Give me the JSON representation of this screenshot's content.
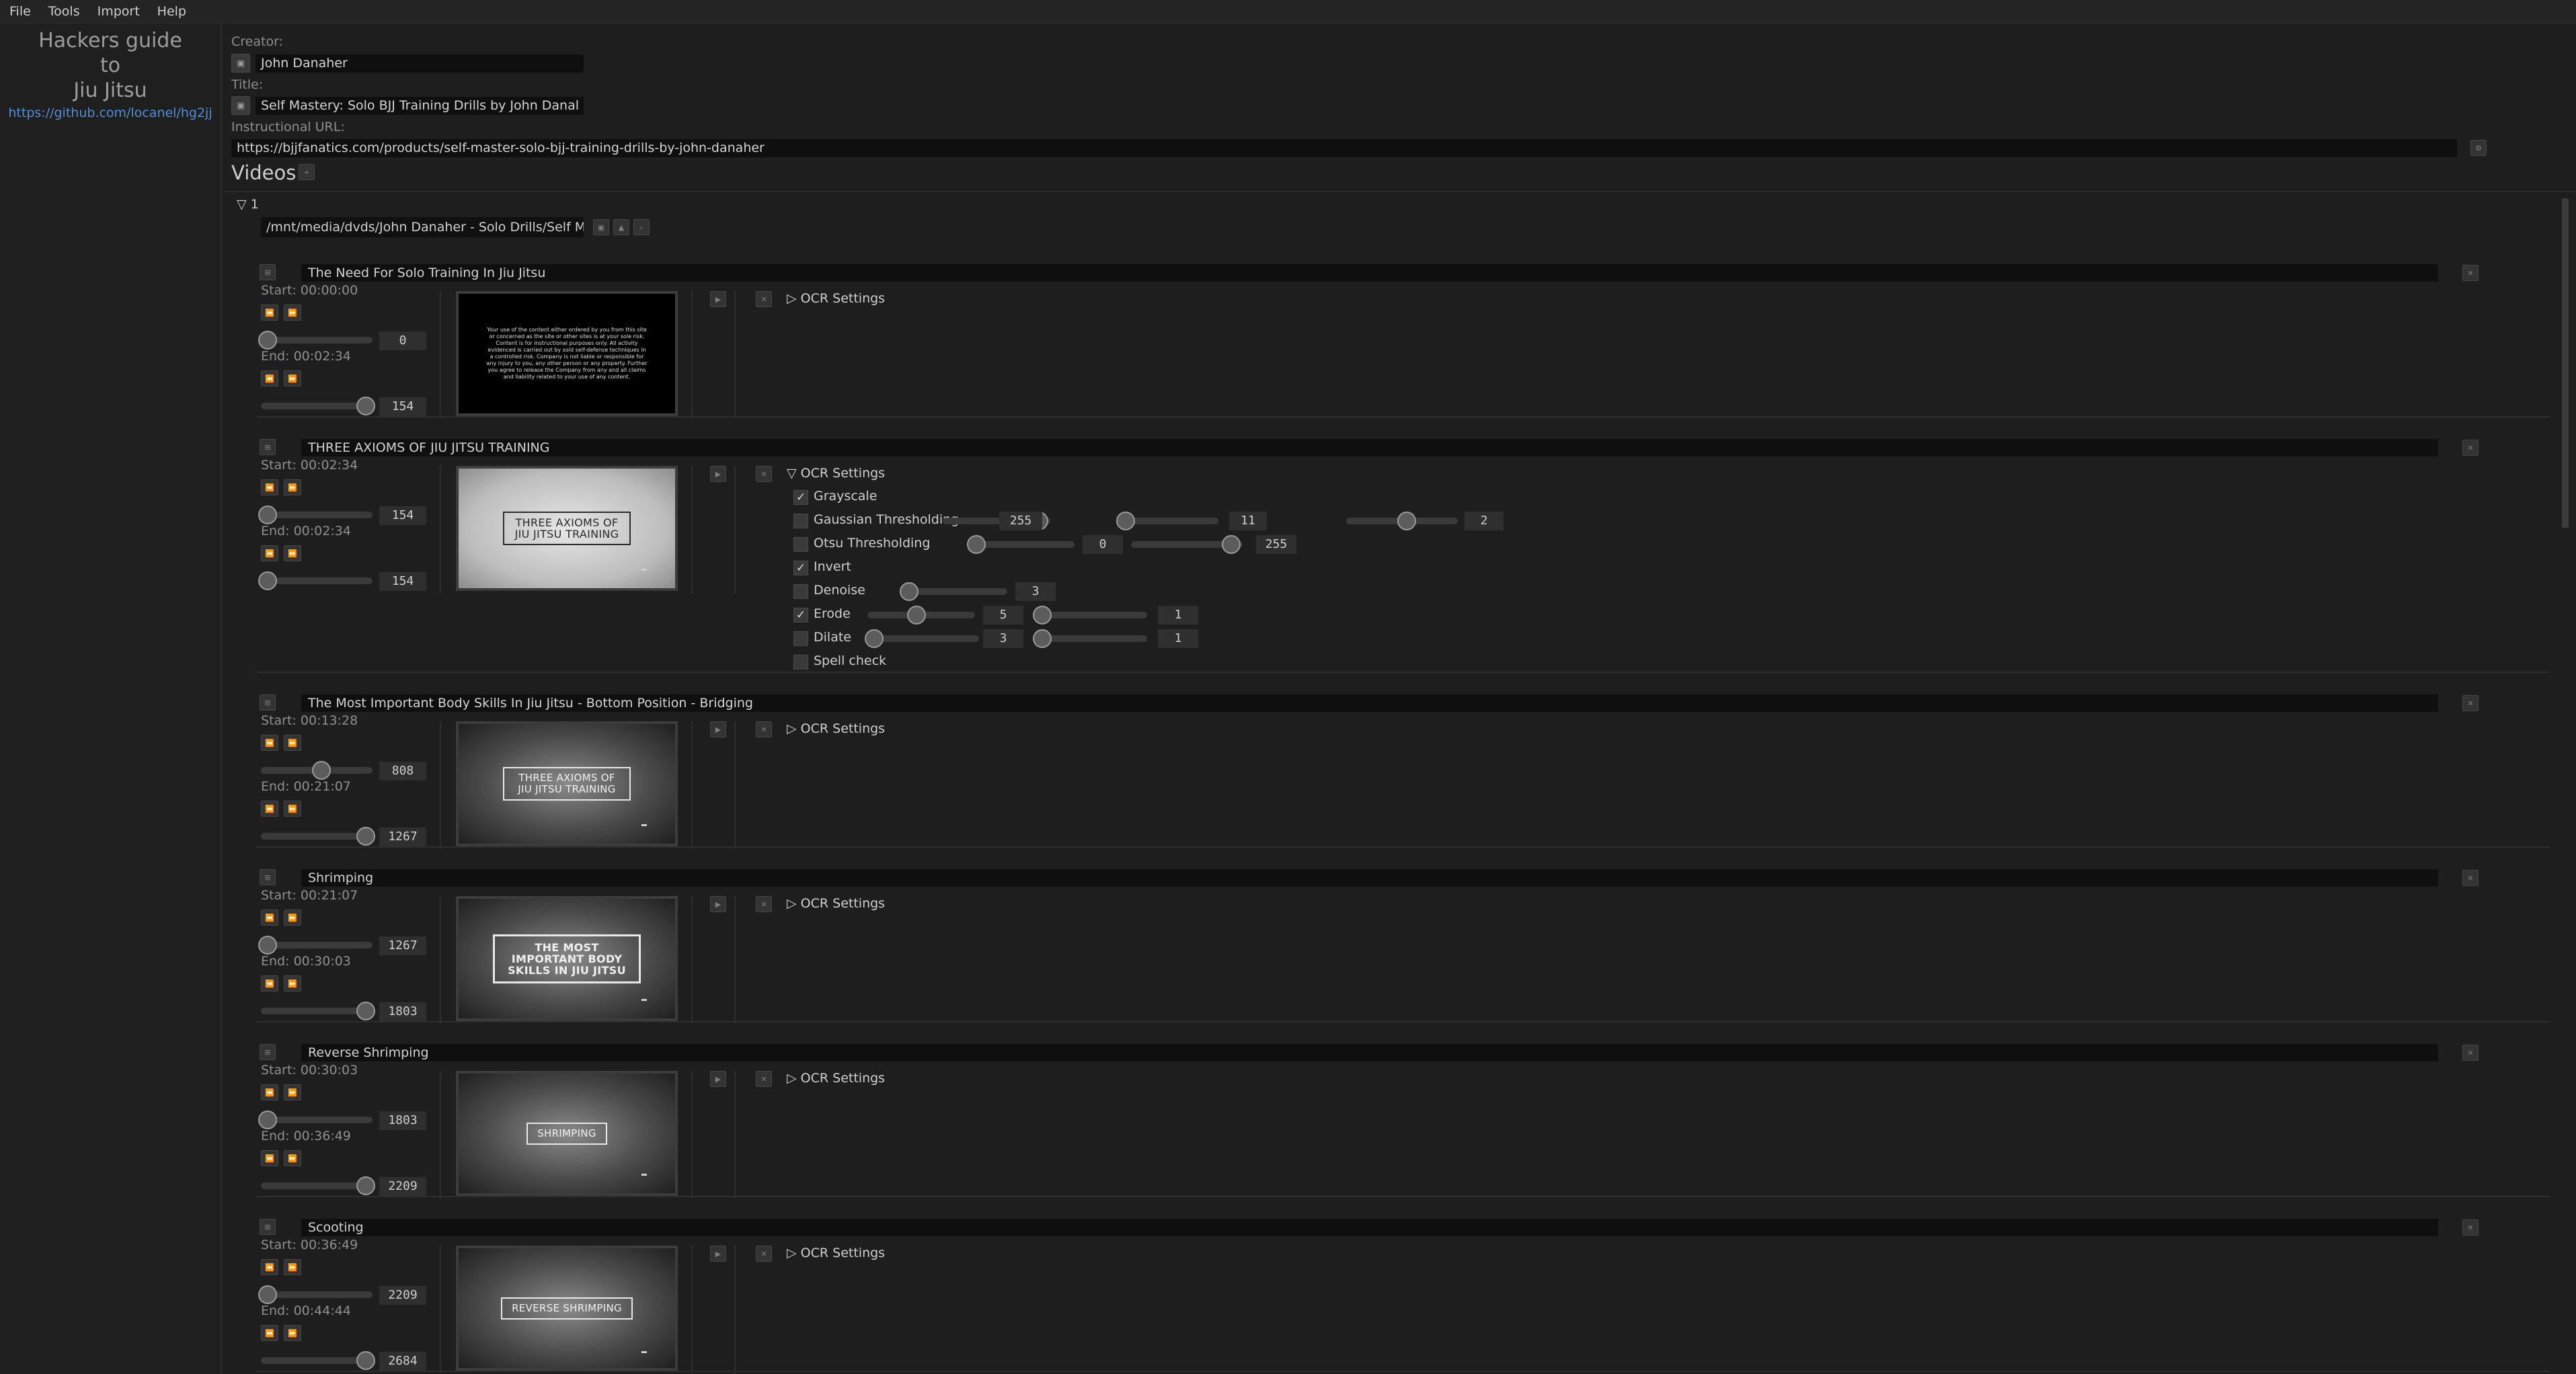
{
  "menu": [
    "File",
    "Tools",
    "Import",
    "Help"
  ],
  "sidebar": {
    "brand_line1": "Hackers guide",
    "brand_line2": "to",
    "brand_line3": "Jiu Jitsu",
    "link": "https://github.com/locanel/hg2jj"
  },
  "form": {
    "creator_label": "Creator:",
    "creator_value": "John Danaher",
    "title_label": "Title:",
    "title_value": "Self Mastery: Solo BJJ Training Drills by John Danal",
    "url_label": "Instructional URL:",
    "url_value": "https://bjjfanatics.com/products/self-master-solo-bjj-training-drills-by-john-danaher"
  },
  "videos": {
    "heading": "Videos",
    "add_glyph": "+",
    "group_label": "1",
    "path": "/mnt/media/dvds/John Danaher - Solo Drills/Self M..."
  },
  "labels": {
    "start_prefix": "Start: ",
    "end_prefix": "End: ",
    "ocr_settings": "OCR Settings"
  },
  "clips": [
    {
      "title": "The Need For Solo Training In Jiu Jitsu",
      "start": "00:00:00",
      "start_frame": "0",
      "end": "00:02:34",
      "end_frame": "154",
      "start_pos": 0.0,
      "end_pos": 1.0,
      "thumb_style": "black",
      "thumb_text": "Your use of the content either ordered by you from this site or concerned as the site or other sites is at your sole risk. Content is for instructional purposes only. All activity evidenced is carried out by sold self-defense techniques in a controlled risk. Company is not liable or responsible for any injury to you, any other person or any property. Further you agree to release the Company from any and all claims and liability related to your use of any content.",
      "ocr_expanded": false
    },
    {
      "title": "THREE AXIOMS OF JIU JITSU TRAINING",
      "start": "00:02:34",
      "start_frame": "154",
      "end": "00:02:34",
      "end_frame": "154",
      "start_pos": 0.0,
      "end_pos": 0.0,
      "thumb_style": "light",
      "thumb_text": "THREE AXIOMS OF JIU JITSU TRAINING",
      "ocr_expanded": true
    },
    {
      "title": "The Most Important Body Skills In Jiu Jitsu - Bottom Position - Bridging",
      "start": "00:13:28",
      "start_frame": "808",
      "end": "00:21:07",
      "end_frame": "1267",
      "start_pos": 0.55,
      "end_pos": 1.0,
      "thumb_style": "dark",
      "thumb_text": "THREE AXIOMS OF JIU JITSU TRAINING",
      "ocr_expanded": false
    },
    {
      "title": "Shrimping",
      "start": "00:21:07",
      "start_frame": "1267",
      "end": "00:30:03",
      "end_frame": "1803",
      "start_pos": 0.0,
      "end_pos": 1.0,
      "thumb_style": "dark",
      "thumb_text": "THE MOST IMPORTANT BODY SKILLS IN JIU JITSU",
      "ocr_expanded": false
    },
    {
      "title": "Reverse Shrimping",
      "start": "00:30:03",
      "start_frame": "1803",
      "end": "00:36:49",
      "end_frame": "2209",
      "start_pos": 0.0,
      "end_pos": 1.0,
      "thumb_style": "dark",
      "thumb_text": "SHRIMPING",
      "ocr_expanded": false
    },
    {
      "title": "Scooting",
      "start": "00:36:49",
      "start_frame": "2209",
      "end": "00:44:44",
      "end_frame": "2684",
      "start_pos": 0.0,
      "end_pos": 1.0,
      "thumb_style": "dark",
      "thumb_text": "REVERSE SHRIMPING",
      "ocr_expanded": false
    }
  ],
  "ocr": {
    "grayscale": {
      "label": "Grayscale",
      "checked": true
    },
    "gaussian": {
      "label": "Gaussian Thresholding",
      "checked": false,
      "v1": "255",
      "v2": "11",
      "v3": "2"
    },
    "otsu": {
      "label": "Otsu Thresholding",
      "checked": false,
      "v1": "0",
      "v2": "255"
    },
    "invert": {
      "label": "Invert",
      "checked": true
    },
    "denoise": {
      "label": "Denoise",
      "checked": false,
      "v1": "3"
    },
    "erode": {
      "label": "Erode",
      "checked": true,
      "v1": "5",
      "v2": "1"
    },
    "dilate": {
      "label": "Dilate",
      "checked": false,
      "v1": "3",
      "v2": "1"
    },
    "spell": {
      "label": "Spell check",
      "checked": false
    }
  },
  "glyphs": {
    "check": "✓",
    "collapsed": "▷",
    "expanded": "▽",
    "play": "▶",
    "close": "✕"
  }
}
